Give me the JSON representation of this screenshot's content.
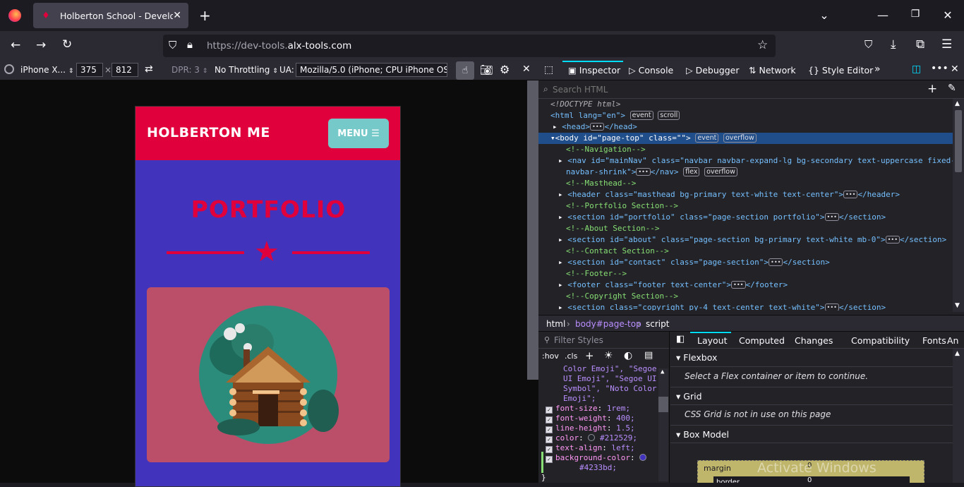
{
  "browser": {
    "tab_title": "Holberton School - Developer t",
    "url_prefix": "https://dev-tools.",
    "url_domain": "alx-tools.com",
    "accent": "#0df"
  },
  "rdm": {
    "device": "iPhone X...",
    "width": "375",
    "times": "×",
    "height": "812",
    "dpr": "DPR: 3",
    "throttling": "No Throttling",
    "ua_label": "UA:",
    "ua_value": "Mozilla/5.0 (iPhone; CPU iPhone OS 12_"
  },
  "site": {
    "brand": "HOLBERTON ME",
    "menu_label": "MENU",
    "section_title": "PORTFOLIO",
    "colors": {
      "primary": "#e0003c",
      "secondary": "#4233bd",
      "teal": "#76c9c9",
      "card": "#bb4f69"
    }
  },
  "devtools": {
    "tabs": [
      "Inspector",
      "Console",
      "Debugger",
      "Network",
      "Style Editor"
    ],
    "search_placeholder": "Search HTML",
    "markup": {
      "doctype": "<!DOCTYPE html>",
      "html_open": "<html lang=\"en\">",
      "head": "<head>",
      "head_close": "</head>",
      "body": "<body id=\"page-top\" class=\"\">",
      "c_nav": "<!--Navigation-->",
      "nav_1": "<nav id=\"mainNav\" class=\"navbar navbar-expand-lg bg-secondary text-uppercase fixed-top",
      "nav_2": "navbar-shrink\">",
      "nav_close": "</nav>",
      "c_masthead": "<!--Masthead-->",
      "header": "<header class=\"masthead bg-primary text-white text-center\">",
      "header_close": "</header>",
      "c_portfolio": "<!--Portfolio Section-->",
      "portfolio": "<section id=\"portfolio\" class=\"page-section portfolio\">",
      "c_about": "<!--About Section-->",
      "about": "<section id=\"about\" class=\"page-section bg-primary text-white mb-0\">",
      "c_contact": "<!--Contact Section-->",
      "contact": "<section id=\"contact\" class=\"page-section\">",
      "c_footer": "<!--Footer-->",
      "footer": "<footer class=\"footer text-center\">",
      "footer_close": "</footer>",
      "c_copyright": "<!--Copyright Section-->",
      "copyright": "<section class=\"copyright py-4 text-center text-white\">",
      "section_close": "</section>",
      "badges": {
        "event": "event",
        "scroll": "scroll",
        "overflow": "overflow",
        "flex": "flex"
      }
    },
    "breadcrumbs": [
      "html",
      "body#page-top",
      "script"
    ],
    "rules": {
      "filter_placeholder": "Filter Styles",
      "hov": ":hov",
      "cls": ".cls",
      "font_lines": [
        "Color Emoji\", \"Segoe",
        "UI Emoji\", \"Segoe UI",
        "Symbol\", \"Noto Color",
        "Emoji\";"
      ],
      "decls": [
        {
          "prop": "font-size",
          "val": "1rem;"
        },
        {
          "prop": "font-weight",
          "val": "400;"
        },
        {
          "prop": "line-height",
          "val": "1.5;"
        },
        {
          "prop": "color",
          "val": "#212529;"
        },
        {
          "prop": "text-align",
          "val": "left;"
        },
        {
          "prop": "background-color",
          "val": ""
        }
      ],
      "bg_value": "#4233bd;",
      "closing": "}"
    },
    "layout_tabs": [
      "Layout",
      "Computed",
      "Changes",
      "Compatibility",
      "Fonts",
      "An"
    ],
    "flexbox": {
      "title": "Flexbox",
      "msg": "Select a Flex container or item to continue."
    },
    "grid": {
      "title": "Grid",
      "msg": "CSS Grid is not in use on this page"
    },
    "boxmodel": {
      "title": "Box Model",
      "margin": "margin",
      "border": "border",
      "zero": "0"
    }
  },
  "watermark": "Activate Windows"
}
